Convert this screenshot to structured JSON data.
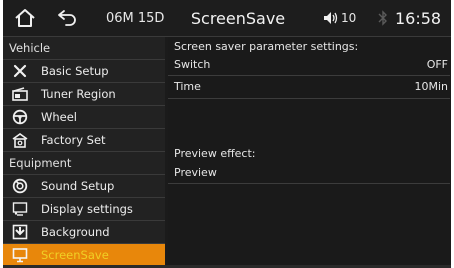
{
  "topbar": {
    "date": "06M 15D",
    "title": "ScreenSave",
    "volume": "10",
    "time": "16:58",
    "icons": {
      "home": "home-icon",
      "back": "back-arrow-icon",
      "volume": "speaker-icon",
      "bluetooth": "bluetooth-icon"
    }
  },
  "sidebar": {
    "sections": [
      {
        "label": "Vehicle",
        "items": [
          {
            "label": "Basic Setup",
            "icon": "tools-icon"
          },
          {
            "label": "Tuner Region",
            "icon": "radio-icon"
          },
          {
            "label": "Wheel",
            "icon": "steering-wheel-icon"
          },
          {
            "label": "Factory Set",
            "icon": "factory-icon"
          }
        ]
      },
      {
        "label": "Equipment",
        "items": [
          {
            "label": "Sound Setup",
            "icon": "sound-icon"
          },
          {
            "label": "Display settings",
            "icon": "display-icon"
          },
          {
            "label": "Background",
            "icon": "background-icon"
          },
          {
            "label": "ScreenSave",
            "icon": "monitor-icon",
            "active": true
          }
        ]
      }
    ]
  },
  "main": {
    "heading": "Screen saver parameter settings:",
    "settings": [
      {
        "label": "Switch",
        "value": "OFF"
      },
      {
        "label": "Time",
        "value": "10Min"
      }
    ],
    "preview_heading": "Preview effect:",
    "preview_label": "Preview"
  },
  "colors": {
    "accent": "#e8870b",
    "active_text": "#f0cf24",
    "bluetooth": "#5a5a5a"
  }
}
